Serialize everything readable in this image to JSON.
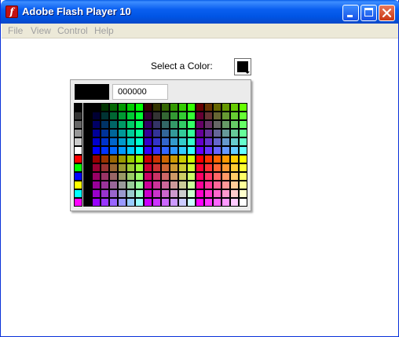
{
  "window": {
    "title": "Adobe Flash Player 10",
    "app_icon_glyph": "f",
    "controls": [
      "minimize-icon",
      "maximize-icon",
      "close-icon"
    ]
  },
  "menu": {
    "items": [
      "File",
      "View",
      "Control",
      "Help"
    ]
  },
  "color_select": {
    "label": "Select a Color:",
    "selected_color": "#000000"
  },
  "picker": {
    "hex_value": "000000",
    "preview_color": "#000000",
    "swatches": [
      [
        "#000000",
        "#000000",
        "#000000",
        "#003300",
        "#006600",
        "#009900",
        "#00cc00",
        "#00ff00",
        "#330000",
        "#333300",
        "#336600",
        "#339900",
        "#33cc00",
        "#33ff00",
        "#660000",
        "#663300",
        "#666600",
        "#669900",
        "#66cc00",
        "#66ff00"
      ],
      [
        "#333333",
        "#000000",
        "#000033",
        "#003333",
        "#006633",
        "#009933",
        "#00cc33",
        "#00ff33",
        "#330033",
        "#333333",
        "#336633",
        "#339933",
        "#33cc33",
        "#33ff33",
        "#660033",
        "#663333",
        "#666633",
        "#669933",
        "#66cc33",
        "#66ff33"
      ],
      [
        "#666666",
        "#000000",
        "#000066",
        "#003366",
        "#006666",
        "#009966",
        "#00cc66",
        "#00ff66",
        "#330066",
        "#333366",
        "#336666",
        "#339966",
        "#33cc66",
        "#33ff66",
        "#660066",
        "#663366",
        "#666666",
        "#669966",
        "#66cc66",
        "#66ff66"
      ],
      [
        "#999999",
        "#000000",
        "#000099",
        "#003399",
        "#006699",
        "#009999",
        "#00cc99",
        "#00ff99",
        "#330099",
        "#333399",
        "#336699",
        "#339999",
        "#33cc99",
        "#33ff99",
        "#660099",
        "#663399",
        "#666699",
        "#669999",
        "#66cc99",
        "#66ff99"
      ],
      [
        "#cccccc",
        "#000000",
        "#0000cc",
        "#0033cc",
        "#0066cc",
        "#0099cc",
        "#00cccc",
        "#00ffcc",
        "#3300cc",
        "#3333cc",
        "#3366cc",
        "#3399cc",
        "#33cccc",
        "#33ffcc",
        "#6600cc",
        "#6633cc",
        "#6666cc",
        "#6699cc",
        "#66cccc",
        "#66ffcc"
      ],
      [
        "#ffffff",
        "#000000",
        "#0000ff",
        "#0033ff",
        "#0066ff",
        "#0099ff",
        "#00ccff",
        "#00ffff",
        "#3300ff",
        "#3333ff",
        "#3366ff",
        "#3399ff",
        "#33ccff",
        "#33ffff",
        "#6600ff",
        "#6633ff",
        "#6666ff",
        "#6699ff",
        "#66ccff",
        "#66ffff"
      ],
      [
        "#ff0000",
        "#000000",
        "#990000",
        "#993300",
        "#996600",
        "#999900",
        "#99cc00",
        "#99ff00",
        "#cc0000",
        "#cc3300",
        "#cc6600",
        "#cc9900",
        "#cccc00",
        "#ccff00",
        "#ff0000",
        "#ff3300",
        "#ff6600",
        "#ff9900",
        "#ffcc00",
        "#ffff00"
      ],
      [
        "#00ff00",
        "#000000",
        "#990033",
        "#993333",
        "#996633",
        "#999933",
        "#99cc33",
        "#99ff33",
        "#cc0033",
        "#cc3333",
        "#cc6633",
        "#cc9933",
        "#cccc33",
        "#ccff33",
        "#ff0033",
        "#ff3333",
        "#ff6633",
        "#ff9933",
        "#ffcc33",
        "#ffff33"
      ],
      [
        "#0000ff",
        "#000000",
        "#990066",
        "#993366",
        "#996666",
        "#999966",
        "#99cc66",
        "#99ff66",
        "#cc0066",
        "#cc3366",
        "#cc6666",
        "#cc9966",
        "#cccc66",
        "#ccff66",
        "#ff0066",
        "#ff3366",
        "#ff6666",
        "#ff9966",
        "#ffcc66",
        "#ffff66"
      ],
      [
        "#ffff00",
        "#000000",
        "#990099",
        "#993399",
        "#996699",
        "#999999",
        "#99cc99",
        "#99ff99",
        "#cc0099",
        "#cc3399",
        "#cc6699",
        "#cc9999",
        "#cccc99",
        "#ccff99",
        "#ff0099",
        "#ff3399",
        "#ff6699",
        "#ff9999",
        "#ffcc99",
        "#ffff99"
      ],
      [
        "#00ffff",
        "#000000",
        "#9900cc",
        "#9933cc",
        "#9966cc",
        "#9999cc",
        "#99cccc",
        "#99ffcc",
        "#cc00cc",
        "#cc33cc",
        "#cc66cc",
        "#cc99cc",
        "#cccccc",
        "#ccffcc",
        "#ff00cc",
        "#ff33cc",
        "#ff66cc",
        "#ff99cc",
        "#ffcccc",
        "#ffffcc"
      ],
      [
        "#ff00ff",
        "#000000",
        "#9900ff",
        "#9933ff",
        "#9966ff",
        "#9999ff",
        "#99ccff",
        "#99ffff",
        "#cc00ff",
        "#cc33ff",
        "#cc66ff",
        "#cc99ff",
        "#ccccff",
        "#ccffff",
        "#ff00ff",
        "#ff33ff",
        "#ff66ff",
        "#ff99ff",
        "#ffccff",
        "#ffffff"
      ]
    ]
  }
}
